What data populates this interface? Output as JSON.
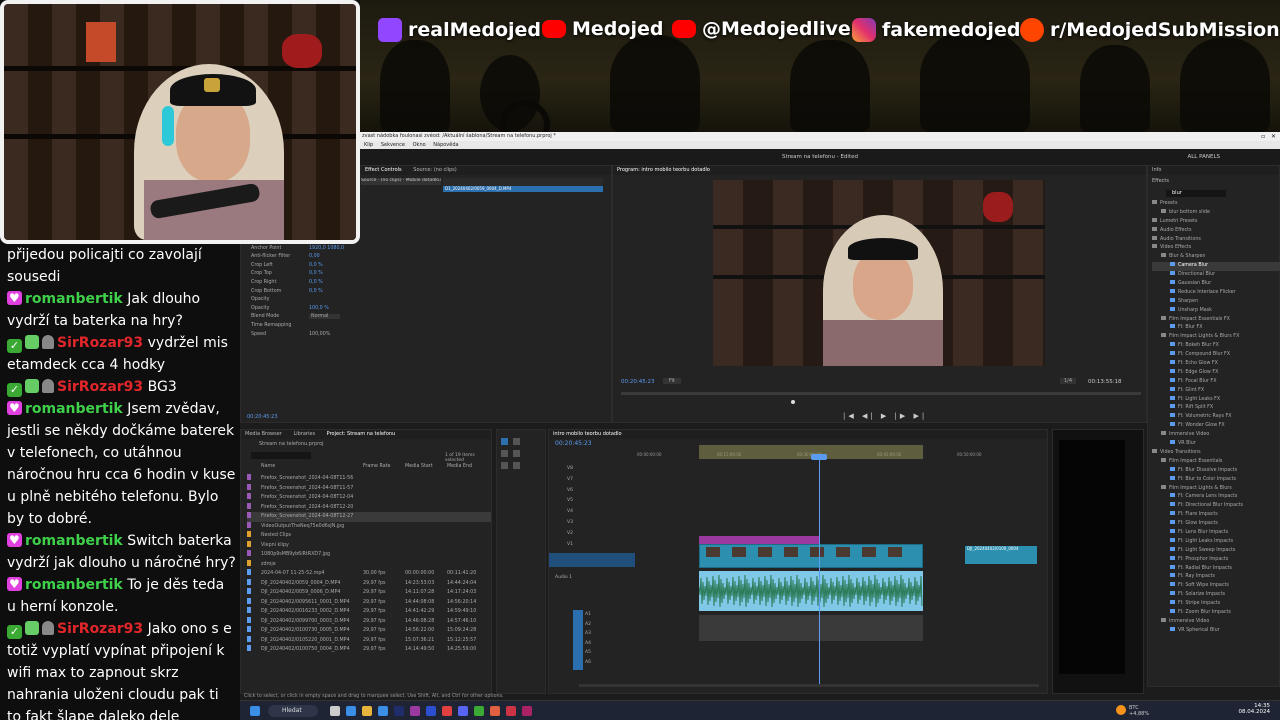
{
  "socials": [
    {
      "icon": "twitch-icon",
      "label": "realMedojed",
      "color": "#9146ff"
    },
    {
      "icon": "youtube-icon",
      "label": "Medojed",
      "color": "#ff0000"
    },
    {
      "icon": "youtube-icon",
      "label": "@Medojedlive",
      "color": "#ff0000"
    },
    {
      "icon": "instagram-icon",
      "label": "fakemedojed",
      "color": "#e1306c"
    },
    {
      "icon": "reddit-icon",
      "label": "r/MedojedSubMissions",
      "color": "#ff4500"
    }
  ],
  "chat": {
    "partial_top": "přijedou policajti co zavolají sousedi",
    "messages": [
      {
        "type": "sub",
        "user": "romanbertik",
        "text": "Jak dlouho vydrží ta baterka na hry?"
      },
      {
        "type": "vip",
        "user": "SirRozar93",
        "text": "vydržel mis etamdeck cca 4 hodky"
      },
      {
        "type": "vip",
        "user": "SirRozar93",
        "text": "BG3"
      },
      {
        "type": "sub",
        "user": "romanbertik",
        "text": "Jsem zvědav, jestli se někdy dočkáme baterek v telefonech, co utáhnou náročnou hru cca 6 hodin v kuse u plně nebitého telefonu. Bylo by to dobré."
      },
      {
        "type": "sub",
        "user": "romanbertik",
        "text": "Switch baterka vydrží jak dlouho u náročné hry?"
      },
      {
        "type": "sub",
        "user": "romanbertik",
        "text": "To je děs teda u herní konzole."
      },
      {
        "type": "vip",
        "user": "SirRozar93",
        "text": "Jako ono s e totiž vyplatí vypínat připojení k wifi max to zapnout skrz nahrania uloženi cloudu pak ti to fakt šlape daleko dele"
      }
    ]
  },
  "premiere": {
    "title_path": "zvast nádobka foulonasi zvéod: /Aktuální šablona/Stream na telefonu.prproj *",
    "menus": [
      "Edit",
      "Klip",
      "Sekvence",
      "Značky",
      "Grafika",
      "Zobrazit",
      "Okno",
      "Nápověda"
    ],
    "sequence_title": "Stream na telefonu - Edited",
    "workspace": "ALL PANELS",
    "source_tabs": [
      "Effect Controls",
      "Audio Clip Mixer",
      "Source: (no clips)"
    ],
    "effect_header": "Source · (no clips)  ·  Mobile dotadlo.mp4  ·  CRUE_20240402",
    "clip_chip": "D1_20240402/0059_0004_D.MP4",
    "effect_rows": [
      {
        "name": "Position",
        "value": "960,0    540,0"
      },
      {
        "name": "Scale",
        "value": "100,0"
      },
      {
        "name": "Rotation",
        "value": "0,0"
      },
      {
        "name": "Anchor Point",
        "value": "1920,0  1080,0"
      },
      {
        "name": "Anti-flicker Filter",
        "value": "0,00"
      },
      {
        "name": "Crop Left",
        "value": "0,0 %"
      },
      {
        "name": "Crop Top",
        "value": "0,0 %"
      },
      {
        "name": "Crop Right",
        "value": "0,0 %"
      },
      {
        "name": "Crop Bottom",
        "value": "0,0 %"
      },
      {
        "name": "Opacity",
        "value": ""
      },
      {
        "name": "Opacity",
        "value": "100,0 %"
      },
      {
        "name": "Blend Mode",
        "value": "Normal"
      },
      {
        "name": "Time Remapping",
        "value": ""
      },
      {
        "name": "Speed",
        "value": "100,00%"
      }
    ],
    "effect_timecode": "00:20:45:23",
    "program_tab": "Program: intro mobilo teorbu dotadlo",
    "program_timecode": "00:20:45:23",
    "program_fit": "Fit",
    "program_quality": "1/4",
    "program_duration": "00:13:55:18",
    "project_tabs": [
      "Media Browser",
      "Libraries",
      "Project: Stream na telefonu"
    ],
    "project_file": "Stream na telefonu.prproj",
    "project_count": "1 of 19 items selected",
    "project_cols": [
      "Name",
      "Frame Rate",
      "Media Start",
      "Media End"
    ],
    "project_items": [
      {
        "name": "Firefox_Screenshot_2024-04-08T11-56",
        "fr": "",
        "ms": "",
        "me": "",
        "color": "#9b59b6"
      },
      {
        "name": "Firefox_Screenshot_2024-04-08T11-57",
        "fr": "",
        "ms": "",
        "me": "",
        "color": "#9b59b6"
      },
      {
        "name": "Firefox_Screenshot_2024-04-08T12-04",
        "fr": "",
        "ms": "",
        "me": "",
        "color": "#9b59b6"
      },
      {
        "name": "Firefox_Screenshot_2024-04-08T12-20",
        "fr": "",
        "ms": "",
        "me": "",
        "color": "#9b59b6"
      },
      {
        "name": "Firefox_Screenshot_2024-04-08T12-27",
        "fr": "",
        "ms": "",
        "me": "",
        "color": "#9b59b6"
      },
      {
        "name": "VideoOutputTheNeq75e0d6sJN.jpg",
        "fr": "",
        "ms": "",
        "me": "",
        "color": "#9b59b6"
      },
      {
        "name": "Nested Clips",
        "fr": "",
        "ms": "",
        "me": "",
        "color": "#e0a030"
      },
      {
        "name": "Vlepni klipy",
        "fr": "",
        "ms": "",
        "me": "",
        "color": "#e0a030"
      },
      {
        "name": "1080p9sMB9yb6iRtRXD7.jpg",
        "fr": "",
        "ms": "",
        "me": "",
        "color": "#9b59b6"
      },
      {
        "name": "zdroje",
        "fr": "",
        "ms": "",
        "me": "",
        "color": "#e0a030"
      },
      {
        "name": "2024-04-07 11-25-52.mp4",
        "fr": "30,00 fps",
        "ms": "00:00:00:00",
        "me": "00:11:41:20",
        "color": "#5b9bf0"
      },
      {
        "name": "DJI_20240402/0059_0004_D.MP4",
        "fr": "29,97 fps",
        "ms": "14:23:53:03",
        "me": "14:44:24:04",
        "color": "#5b9bf0"
      },
      {
        "name": "DJI_20240402/0059_0006_D.MP4",
        "fr": "29,97 fps",
        "ms": "14:11:07:28",
        "me": "14:17:24:03",
        "color": "#5b9bf0"
      },
      {
        "name": "DJI_20240402/0095611_0001_D.MP4",
        "fr": "29,97 fps",
        "ms": "14:44:08:08",
        "me": "14:56:20:14",
        "color": "#5b9bf0"
      },
      {
        "name": "DJI_20240402/0016233_0002_D.MP4",
        "fr": "29,97 fps",
        "ms": "14:41:42:29",
        "me": "14:59:49:10",
        "color": "#5b9bf0"
      },
      {
        "name": "DJI_20240402/0099700_0003_D.MP4",
        "fr": "29,97 fps",
        "ms": "14:46:08:28",
        "me": "14:57:46:10",
        "color": "#5b9bf0"
      },
      {
        "name": "DJI_20240402/0100730_0005_D.MP4",
        "fr": "29,97 fps",
        "ms": "14:56:22:00",
        "me": "15:09:24:28",
        "color": "#5b9bf0"
      },
      {
        "name": "DJI_20240402/0105220_0001_D.MP4",
        "fr": "29,97 fps",
        "ms": "15:07:36:21",
        "me": "15:12:25:57",
        "color": "#5b9bf0"
      },
      {
        "name": "DJI_20240402/0100750_0004_D.MP4",
        "fr": "29,97 fps",
        "ms": "14:14:49:50",
        "me": "14:25:59:00",
        "color": "#5b9bf0"
      }
    ],
    "timeline_tab": "intro mobilo teorbu dotadlo",
    "timeline_timecode": "00:20:45:23",
    "timeline_ruler": [
      "00:00:00:00",
      "00:15:00:00",
      "00:30:00:00",
      "00:45:00:00",
      "00:50:00:00"
    ],
    "video_tracks": [
      "V8",
      "V7",
      "V6",
      "V5",
      "V4",
      "V3",
      "V2",
      "V1"
    ],
    "audio_tracks": [
      "A1",
      "A2",
      "A3",
      "A4",
      "A5",
      "A6"
    ],
    "audio_label": "Audio 1",
    "end_clip_label": "DJI_20240402/0100_0004",
    "status_bar": "Click to select, or click in empty space and drag to marquee select. Use Shift, Alt, and Ctrl for other options.",
    "info_tab": "Info",
    "effects_tab": "Effects",
    "effects_search": "blur",
    "effects_tree": [
      {
        "label": "Presets",
        "level": 0
      },
      {
        "label": "blur bottom slide",
        "level": 1
      },
      {
        "label": "Lumetri Presets",
        "level": 0
      },
      {
        "label": "Audio Effects",
        "level": 0
      },
      {
        "label": "Audio Transitions",
        "level": 0
      },
      {
        "label": "Video Effects",
        "level": 0
      },
      {
        "label": "Blur & Sharpen",
        "level": 1
      },
      {
        "label": "Camera Blur",
        "level": 2
      },
      {
        "label": "Directional Blur",
        "level": 2
      },
      {
        "label": "Gaussian Blur",
        "level": 2
      },
      {
        "label": "Reduce Interlace Flicker",
        "level": 2
      },
      {
        "label": "Sharpen",
        "level": 2
      },
      {
        "label": "Unsharp Mask",
        "level": 2
      },
      {
        "label": "Film Impact Essentials FX",
        "level": 1
      },
      {
        "label": "FI: Blur FX",
        "level": 2
      },
      {
        "label": "Film Impact Lights & Blurs FX",
        "level": 1
      },
      {
        "label": "FI: Bokeh Blur FX",
        "level": 2
      },
      {
        "label": "FI: Compound Blur FX",
        "level": 2
      },
      {
        "label": "FI: Echo Glow FX",
        "level": 2
      },
      {
        "label": "FI: Edge Glow FX",
        "level": 2
      },
      {
        "label": "FI: Focal Blur FX",
        "level": 2
      },
      {
        "label": "FI: Glint FX",
        "level": 2
      },
      {
        "label": "FI: Light Leaks FX",
        "level": 2
      },
      {
        "label": "FI: Rift Split FX",
        "level": 2
      },
      {
        "label": "FI: Volumetric Rays FX",
        "level": 2
      },
      {
        "label": "FI: Wonder Glow FX",
        "level": 2
      },
      {
        "label": "Immersive Video",
        "level": 1
      },
      {
        "label": "VR Blur",
        "level": 2
      },
      {
        "label": "Video Transitions",
        "level": 0
      },
      {
        "label": "Film Impact Essentials",
        "level": 1
      },
      {
        "label": "FI: Blur Dissolve Impacts",
        "level": 2
      },
      {
        "label": "FI: Blur to Color Impacts",
        "level": 2
      },
      {
        "label": "Film Impact Lights & Blurs",
        "level": 1
      },
      {
        "label": "FI: Camera Lens Impacts",
        "level": 2
      },
      {
        "label": "FI: Directional Blur Impacts",
        "level": 2
      },
      {
        "label": "FI: Flare Impacts",
        "level": 2
      },
      {
        "label": "FI: Glow Impacts",
        "level": 2
      },
      {
        "label": "FI: Lens Blur Impacts",
        "level": 2
      },
      {
        "label": "FI: Light Leaks Impacts",
        "level": 2
      },
      {
        "label": "FI: Light Sweep Impacts",
        "level": 2
      },
      {
        "label": "FI: Phosphor Impacts",
        "level": 2
      },
      {
        "label": "FI: Radial Blur Impacts",
        "level": 2
      },
      {
        "label": "FI: Ray Impacts",
        "level": 2
      },
      {
        "label": "FI: Soft Wipe Impacts",
        "level": 2
      },
      {
        "label": "FI: Solarize Impacts",
        "level": 2
      },
      {
        "label": "FI: Stripe Impacts",
        "level": 2
      },
      {
        "label": "FI: Zoom Blur Impacts",
        "level": 2
      },
      {
        "label": "Immersive Video",
        "level": 1
      },
      {
        "label": "VR Spherical Blur",
        "level": 2
      }
    ]
  },
  "taskbar": {
    "search": "Hledat",
    "weather": "BTC +4,88%",
    "time": "14:35",
    "date": "08.04.2024"
  }
}
